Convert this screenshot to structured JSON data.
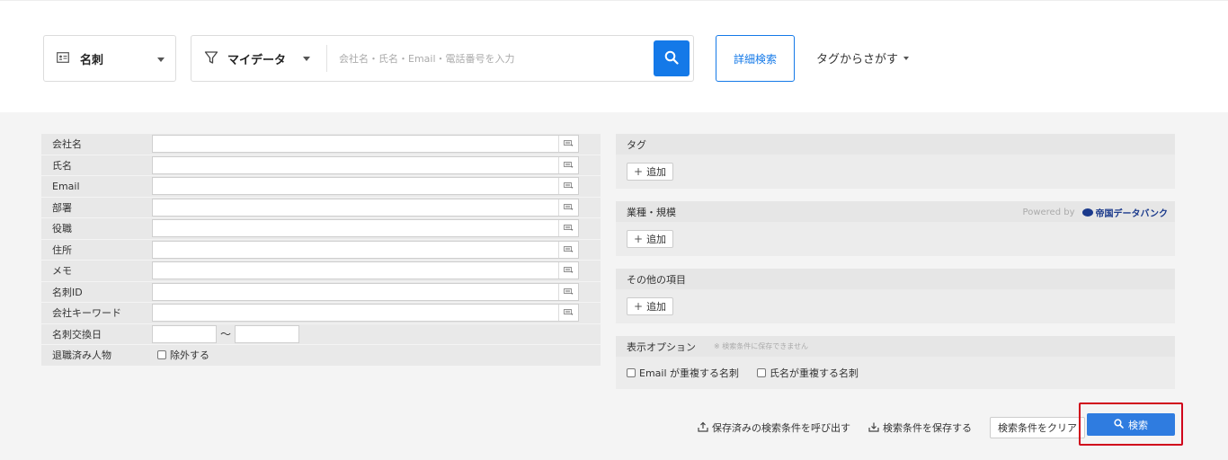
{
  "topbar": {
    "type_select": {
      "label": "名刺",
      "icon": "card-icon"
    },
    "filter": {
      "label": "マイデータ",
      "icon": "filter-icon"
    },
    "search": {
      "placeholder": "会社名・氏名・Email・電話番号を入力",
      "value": ""
    },
    "advanced_label": "詳細検索",
    "tag_search_label": "タグからさがす"
  },
  "form": {
    "fields": [
      {
        "label": "会社名"
      },
      {
        "label": "氏名"
      },
      {
        "label": "Email"
      },
      {
        "label": "部署"
      },
      {
        "label": "役職"
      },
      {
        "label": "住所"
      },
      {
        "label": "メモ"
      },
      {
        "label": "名刺ID"
      },
      {
        "label": "会社キーワード"
      }
    ],
    "date_label": "名刺交換日",
    "date_sep": "〜",
    "retired_label": "退職済み人物",
    "exclude_label": "除外する"
  },
  "right": {
    "tag": {
      "title": "タグ",
      "add_label": "追加"
    },
    "industry": {
      "title": "業種・規模",
      "powered_by": "Powered by",
      "logo_text": "帝国データバンク",
      "add_label": "追加"
    },
    "other": {
      "title": "その他の項目",
      "add_label": "追加"
    },
    "options": {
      "title": "表示オプション",
      "note": "※ 検索条件に保存できません",
      "dup_email": "Email が重複する名刺",
      "dup_name": "氏名が重複する名刺"
    }
  },
  "actions": {
    "load_saved": "保存済みの検索条件を呼び出す",
    "save": "検索条件を保存する",
    "clear": "検索条件をクリア",
    "search": "検索"
  },
  "colors": {
    "accent": "#1479e8",
    "highlight": "#d0021b"
  }
}
